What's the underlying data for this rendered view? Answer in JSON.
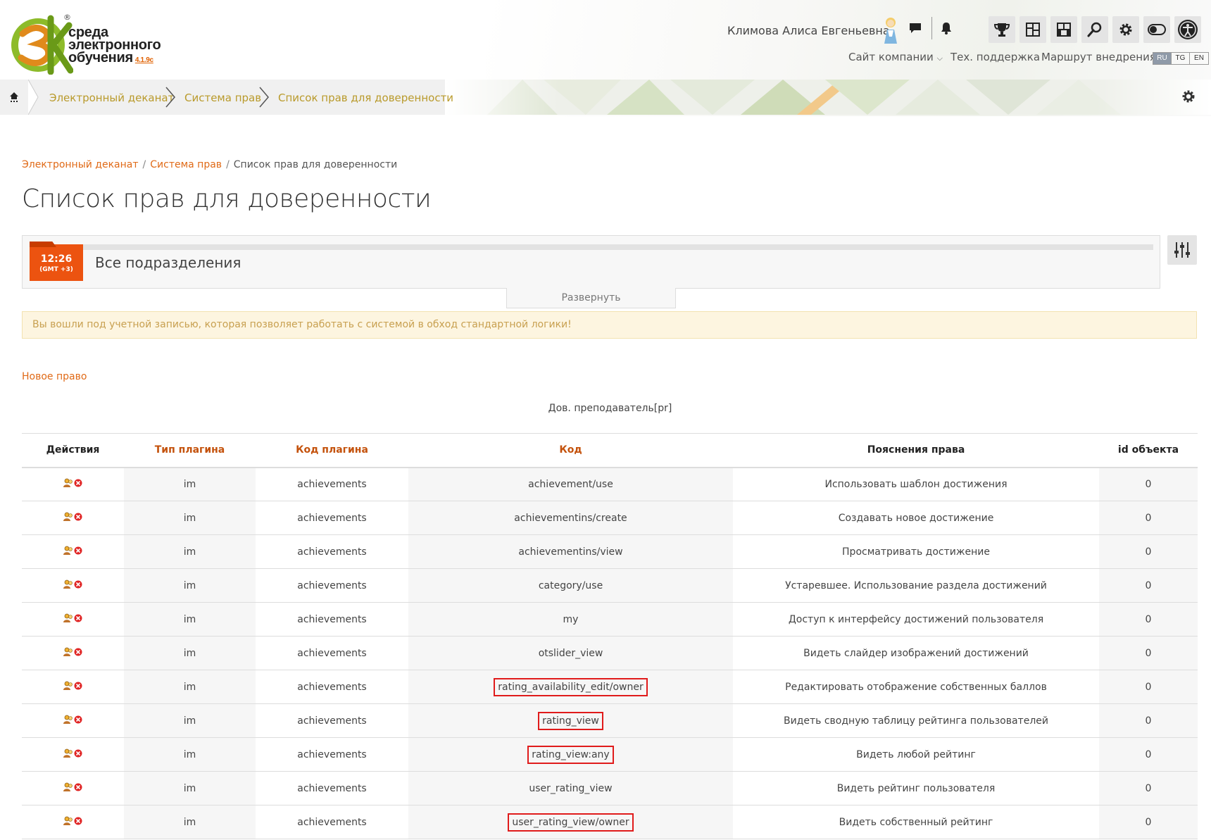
{
  "header": {
    "logo_line1": "среда",
    "logo_line2": "электронного",
    "logo_line3": "обучения",
    "logo_version": "4.1.9c",
    "logo_reg": "®",
    "user_name": "Климова Алиса Евгеньевна",
    "links": {
      "company_site": "Сайт компании",
      "support": "Тех. поддержка",
      "route": "Маршрут внедрения"
    },
    "languages": [
      "RU",
      "TG",
      "EN"
    ],
    "active_language": "RU",
    "accent_color": "#ec5310"
  },
  "navbar": {
    "items": [
      "Электронный деканат",
      "Система прав",
      "Список прав для доверенности"
    ]
  },
  "breadcrumb": {
    "items": [
      "Электронный деканат",
      "Система прав"
    ],
    "current": "Список прав для доверенности",
    "separator": "/"
  },
  "page_title": "Список прав для доверенности",
  "panel": {
    "time": "12:26",
    "timezone": "(GMT +3)",
    "label": "Все подразделения",
    "expand": "Развернуть"
  },
  "warning": "Вы вошли под учетной записью, которая позволяет работать с системой в обход стандартной логики!",
  "new_right": "Новое право",
  "table": {
    "caption": "Дов. преподаватель[pr]",
    "headers": [
      "Действия",
      "Тип плагина",
      "Код плагина",
      "Код",
      "Пояснения права",
      "id объекта"
    ],
    "rows": [
      {
        "type": "im",
        "plugin": "achievements",
        "code": "achievement/use",
        "desc": "Использовать шаблон достижения",
        "id": "0",
        "highlight": false
      },
      {
        "type": "im",
        "plugin": "achievements",
        "code": "achievementins/create",
        "desc": "Создавать новое достижение",
        "id": "0",
        "highlight": false
      },
      {
        "type": "im",
        "plugin": "achievements",
        "code": "achievementins/view",
        "desc": "Просматривать достижение",
        "id": "0",
        "highlight": false
      },
      {
        "type": "im",
        "plugin": "achievements",
        "code": "category/use",
        "desc": "Устаревшее. Использование раздела достижений",
        "id": "0",
        "highlight": false
      },
      {
        "type": "im",
        "plugin": "achievements",
        "code": "my",
        "desc": "Доступ к интерфейсу достижений пользователя",
        "id": "0",
        "highlight": false
      },
      {
        "type": "im",
        "plugin": "achievements",
        "code": "otslider_view",
        "desc": "Видеть слайдер изображений достижений",
        "id": "0",
        "highlight": false
      },
      {
        "type": "im",
        "plugin": "achievements",
        "code": "rating_availability_edit/owner",
        "desc": "Редактировать отображение собственных баллов",
        "id": "0",
        "highlight": true
      },
      {
        "type": "im",
        "plugin": "achievements",
        "code": "rating_view",
        "desc": "Видеть сводную таблицу рейтинга пользователей",
        "id": "0",
        "highlight": true
      },
      {
        "type": "im",
        "plugin": "achievements",
        "code": "rating_view:any",
        "desc": "Видеть любой рейтинг",
        "id": "0",
        "highlight": true
      },
      {
        "type": "im",
        "plugin": "achievements",
        "code": "user_rating_view",
        "desc": "Видеть рейтинг пользователя",
        "id": "0",
        "highlight": false
      },
      {
        "type": "im",
        "plugin": "achievements",
        "code": "user_rating_view/owner",
        "desc": "Видеть собственный рейтинг",
        "id": "0",
        "highlight": true
      }
    ]
  }
}
